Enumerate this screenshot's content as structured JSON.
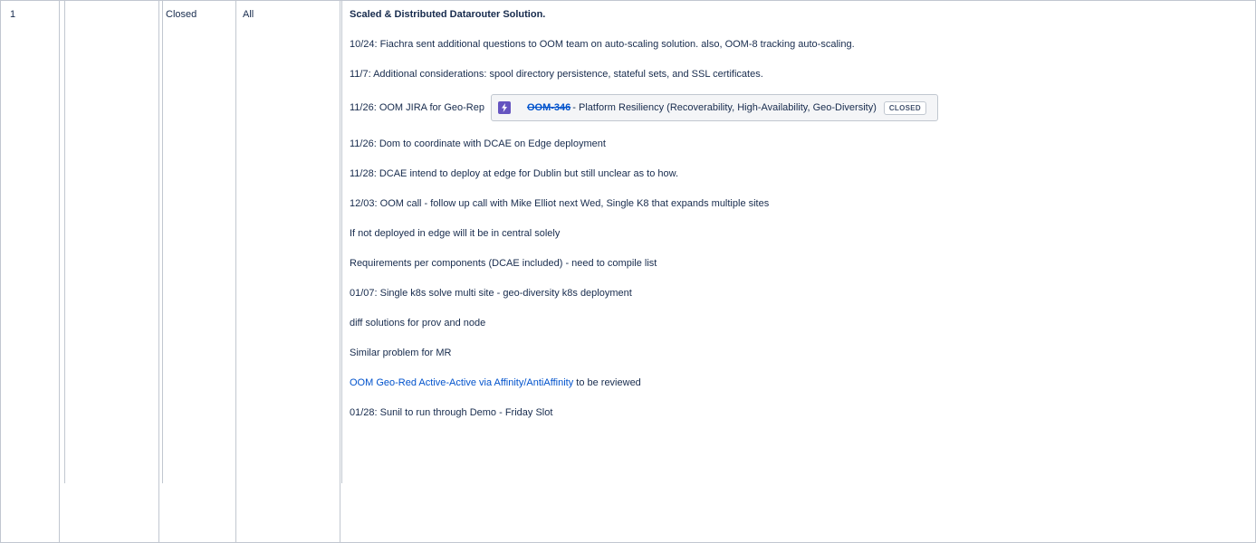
{
  "row": {
    "number": "1",
    "owner": "",
    "status": "Closed",
    "scope": "All",
    "title": "Scaled & Distributed Datarouter Solution.",
    "notes": [
      "10/24: Fiachra sent additional questions to OOM team on auto-scaling solution. also, OOM-8 tracking auto-scaling.",
      "11/7: Additional considerations: spool directory persistence, stateful sets, and SSL certificates."
    ],
    "jira_prefix": "11/26: OOM JIRA for Geo-Rep",
    "jira": {
      "key": "OOM-346",
      "summary": " - Platform Resiliency (Recoverability, High-Availability, Geo-Diversity)",
      "status": "CLOSED",
      "icon": "lightning-icon"
    },
    "notes_after": [
      "11/26: Dom to coordinate with DCAE on Edge deployment",
      "11/28: DCAE intend to deploy at edge for Dublin but still unclear as to how.",
      "12/03: OOM call - follow up call with Mike Elliot next Wed, Single K8 that expands multiple sites",
      "If not deployed in edge will it be in central solely",
      "Requirements per components (DCAE included) - need to compile list",
      "01/07: Single k8s solve multi site - geo-diversity k8s deployment",
      "diff solutions for prov and node",
      "Similar problem for MR"
    ],
    "link_text": "OOM Geo-Red Active-Active via Affinity/AntiAffinity",
    "link_suffix": " to be reviewed",
    "last_note": "01/28: Sunil to run through Demo - Friday Slot"
  },
  "colors": {
    "link": "#0052cc",
    "border": "#c1c7d0",
    "jira_icon": "#6554c0"
  }
}
